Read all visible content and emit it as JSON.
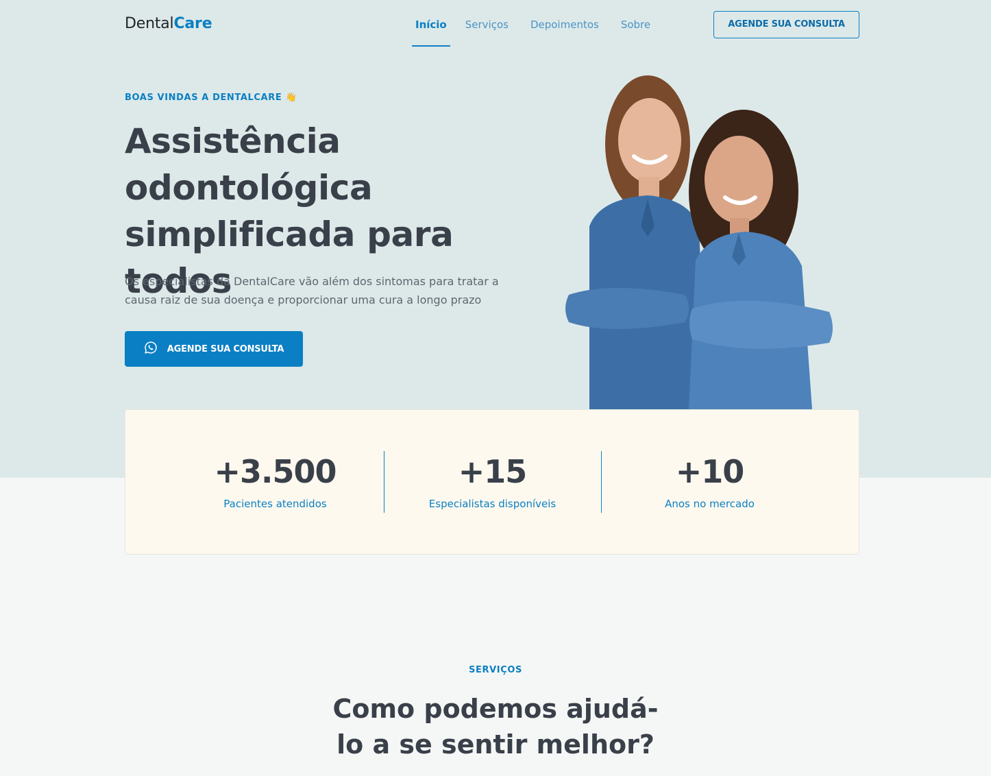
{
  "header": {
    "logo_part1": "Dental",
    "logo_part2": "Care",
    "nav": [
      "Início",
      "Serviços",
      "Depoimentos",
      "Sobre"
    ],
    "cta": "AGENDE SUA CONSULTA"
  },
  "hero": {
    "eyebrow": "BOAS VINDAS A DENTALCARE",
    "eyebrow_emoji": "👋",
    "title": "Assistência odontológica simplificada para todos",
    "subtitle": "Os especialistas da DentalCare vão além dos sintomas para tratar a causa raiz de sua doença e proporcionar uma cura a longo prazo",
    "cta": "AGENDE SUA CONSULTA",
    "cta_icon": "whatsapp-icon"
  },
  "stats": [
    {
      "value": "+3.500",
      "label": "Pacientes atendidos"
    },
    {
      "value": "+15",
      "label": "Especialistas disponíveis"
    },
    {
      "value": "+10",
      "label": "Anos no mercado"
    }
  ],
  "services": {
    "eyebrow": "SERVIÇOS",
    "title": "Como podemos ajudá-lo a se sentir melhor?"
  },
  "colors": {
    "accent": "#0b7fc4",
    "hero_bg": "#dde9e9",
    "stats_bg": "#fdf9ef",
    "text_dark": "#3a4049"
  }
}
